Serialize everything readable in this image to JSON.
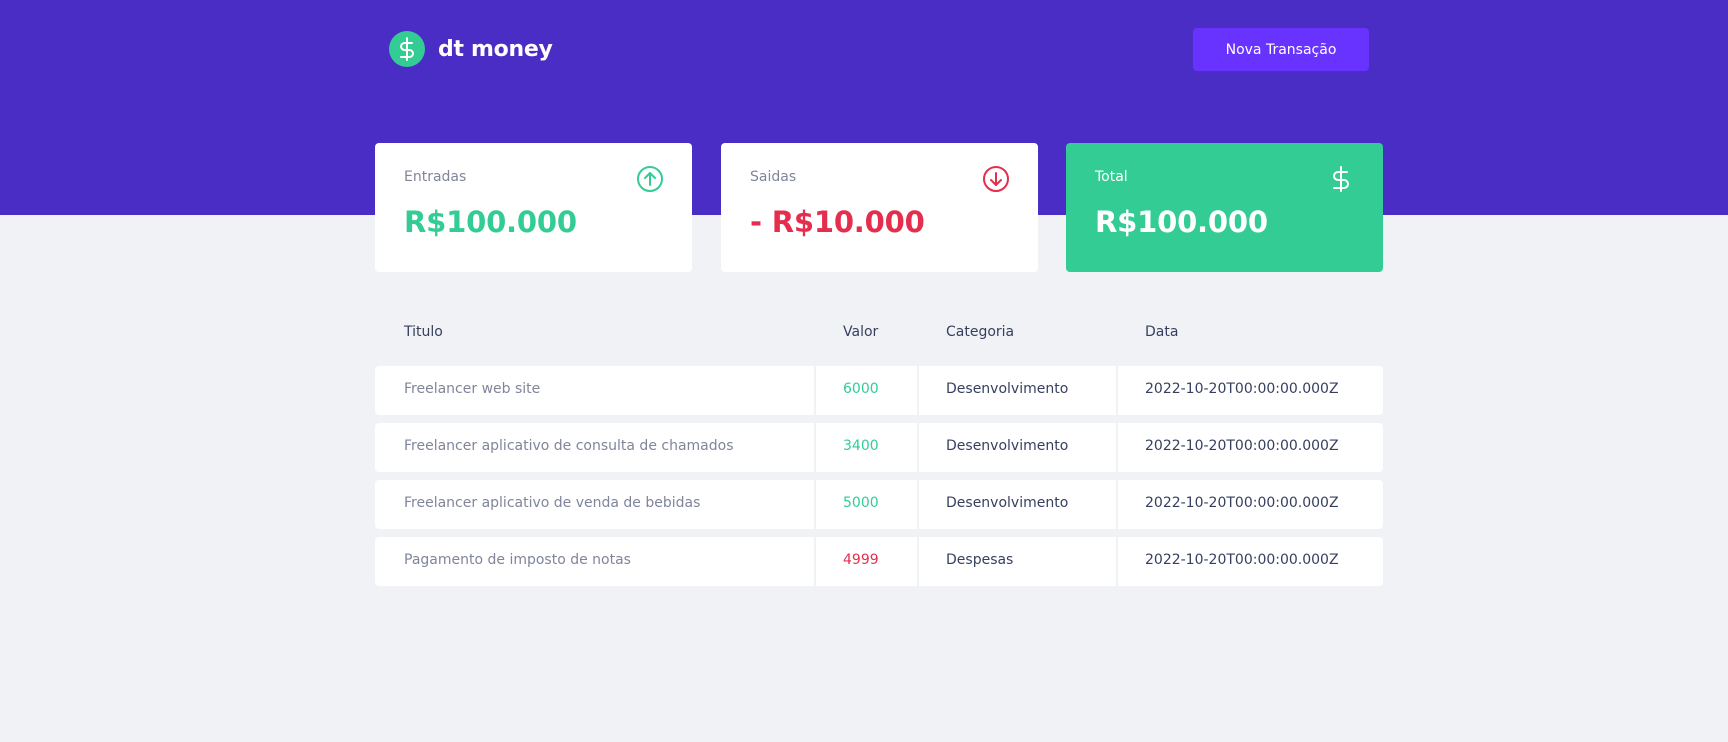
{
  "header": {
    "logo_text": "dt money",
    "logo_icon": "dollar-icon",
    "new_transaction_label": "Nova Transação"
  },
  "summary": {
    "income": {
      "label": "Entradas",
      "amount": "R$100.000",
      "icon": "arrow-up-circle-icon"
    },
    "outcome": {
      "label": "Saidas",
      "amount": "- R$10.000",
      "icon": "arrow-down-circle-icon"
    },
    "total": {
      "label": "Total",
      "amount": "R$100.000",
      "icon": "dollar-icon"
    }
  },
  "table": {
    "headers": {
      "title": "Titulo",
      "value": "Valor",
      "category": "Categoria",
      "date": "Data"
    },
    "rows": [
      {
        "title": "Freelancer web site",
        "value": "6000",
        "type": "deposit",
        "category": "Desenvolvimento",
        "date": "2022-10-20T00:00:00.000Z"
      },
      {
        "title": "Freelancer aplicativo de consulta de chamados",
        "value": "3400",
        "type": "deposit",
        "category": "Desenvolvimento",
        "date": "2022-10-20T00:00:00.000Z"
      },
      {
        "title": "Freelancer aplicativo de venda de bebidas",
        "value": "5000",
        "type": "deposit",
        "category": "Desenvolvimento",
        "date": "2022-10-20T00:00:00.000Z"
      },
      {
        "title": "Pagamento de imposto de notas",
        "value": "4999",
        "type": "withdraw",
        "category": "Despesas",
        "date": "2022-10-20T00:00:00.000Z"
      }
    ]
  },
  "colors": {
    "header_bg": "#4a2dc4",
    "button_bg": "#6933ff",
    "green": "#33cc95",
    "red": "#e52e4d",
    "text_title": "#363f5f",
    "text_body": "#80859a",
    "page_bg": "#f0f2f5"
  }
}
